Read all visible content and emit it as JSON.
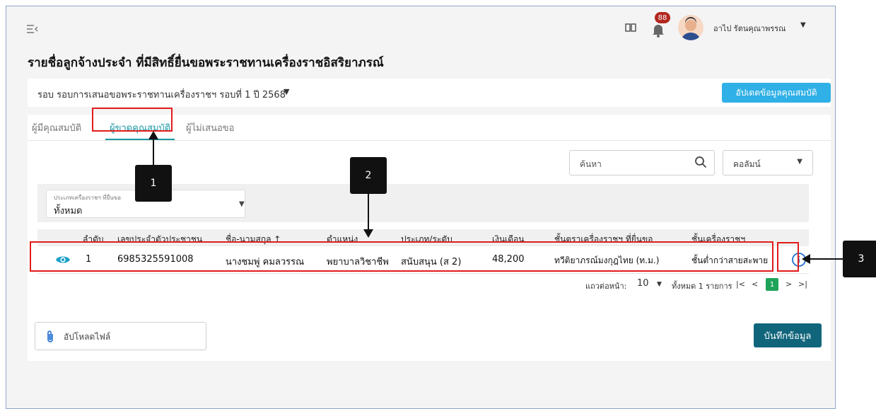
{
  "header": {
    "menu_icon": "menu-collapse-icon",
    "book_icon": "book-icon",
    "bell_icon": "bell-icon",
    "notification_count": "88",
    "user_name": "อาไป รัตนคุณาพรรณ"
  },
  "page_title": "รายชื่อลูกจ้างประจำ ที่มีสิทธิ์ยื่นขอพระราชทานเครื่องราชอิสริยาภรณ์",
  "round": {
    "label": "รอบ  รอบการเสนอขอพระราชทานเครื่องราชฯ รอบที่ 1 ปี 2568",
    "update_button": "อัปเดตข้อมูลคุณสมบัติ"
  },
  "tabs": [
    {
      "label": "ผู้มีคุณสมบัติ"
    },
    {
      "label": "ผู้ขาดคุณสมบัติ"
    },
    {
      "label": "ผู้ไม่เสนอขอ"
    }
  ],
  "search": {
    "placeholder": "ค้นหา"
  },
  "column_select": {
    "label": "คอลัมน์"
  },
  "filter": {
    "label": "ประเภทเครื่องราชฯ ที่ยื่นขอ",
    "value": "ทั้งหมด"
  },
  "table": {
    "headers": [
      "ลำดับ",
      "เลขประจำตัวประชาชน",
      "ชื่อ-นามสกุล ↑",
      "ตำแหน่ง",
      "ประเภท/ระดับ",
      "เงินเดือน",
      "ชั้นตราเครื่องราชฯ ที่ยื่นขอ",
      "ชั้นเครื่องราชฯ"
    ],
    "rows": [
      {
        "no": "1",
        "id": "6985325591008",
        "name": "นางชมพู่ คมลวรรณ",
        "position": "พยาบาลวิชาชีพ",
        "type": "สนับสนุน (ส 2)",
        "salary": "48,200",
        "requested": "ทวีติยาภรณ์มงกุฎไทย (ท.ม.)",
        "class": "ชั้นต่ำกว่าสายสะพาย"
      }
    ]
  },
  "pager": {
    "rows_per_page_label": "แถวต่อหน้า:",
    "rows_per_page": "10",
    "total": "ทั้งหมด 1 รายการ",
    "current_page": "1"
  },
  "upload": {
    "label": "อัปโหลดไฟล์"
  },
  "save_button": "บันทึกข้อมูล",
  "callouts": [
    "1",
    "2",
    "3"
  ],
  "colors": {
    "accent": "#1b9aa5",
    "update_button": "#2fb0e6",
    "save_button": "#11657b",
    "highlight": "#e11c1c",
    "badge": "#b3261e"
  }
}
